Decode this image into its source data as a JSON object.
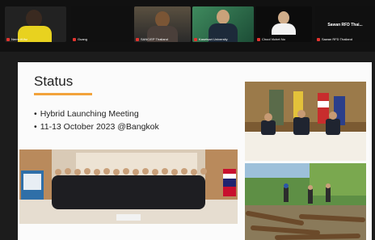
{
  "participants": [
    {
      "name": "Nerm #Vbz"
    },
    {
      "name": "Guang"
    },
    {
      "name": "SANC/EP Thailand"
    },
    {
      "name": "Kasetsart University"
    },
    {
      "name": "Chool Vichet No"
    },
    {
      "name": "Sawan RFD Thailand",
      "big_name": "Sawan RFD Thai..."
    }
  ],
  "slide": {
    "title": "Status",
    "bullets": [
      "Hybrid Launching Meeting",
      "11-13 October 2023 @Bangkok"
    ]
  },
  "colors": {
    "accent": "#f2a33b",
    "mic_muted": "#e2342f"
  }
}
